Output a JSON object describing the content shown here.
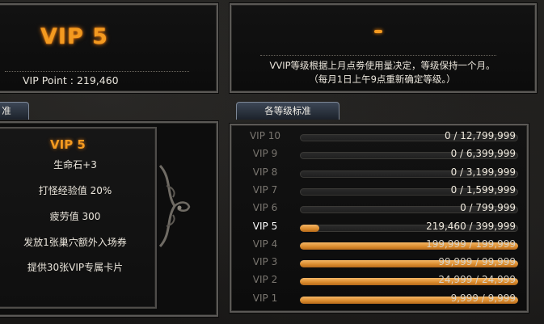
{
  "summary": {
    "level": "VIP 5",
    "point_line": "VIP Point : 219,460"
  },
  "info": {
    "desc_line1": "VVIP等级根据上月点劵使用量决定，等级保持一个月。",
    "desc_line2": "（每月1日上午9点重新确定等级。）"
  },
  "tabs": {
    "left_partial": "准",
    "right": "各等级标准"
  },
  "benefits": {
    "level": "VIP 5",
    "items": [
      "生命石+3",
      "打怪经验值 20%",
      "疲劳值 300",
      "发放1张巢穴额外入场券",
      "提供30张VIP专属卡片"
    ]
  },
  "levels": [
    {
      "label": "VIP 10",
      "text": "0 / 12,799,999",
      "progress": 0
    },
    {
      "label": "VIP 9",
      "text": "0 / 6,399,999",
      "progress": 0
    },
    {
      "label": "VIP 8",
      "text": "0 / 3,199,999",
      "progress": 0
    },
    {
      "label": "VIP 7",
      "text": "0 / 1,599,999",
      "progress": 0
    },
    {
      "label": "VIP 6",
      "text": "0 / 799,999",
      "progress": 0
    },
    {
      "label": "VIP 5",
      "text": "219,460 / 399,999",
      "progress": 0.09,
      "current": true
    },
    {
      "label": "VIP 4",
      "text": "199,999 / 199,999",
      "progress": 1
    },
    {
      "label": "VIP 3",
      "text": "99,999 / 99,999",
      "progress": 1
    },
    {
      "label": "VIP 2",
      "text": "24,999 / 24,999",
      "progress": 1
    },
    {
      "label": "VIP 1",
      "text": "9,999 / 9,999",
      "progress": 1
    }
  ],
  "colors": {
    "accent_orange": "#f39a20",
    "bar_fill": "#d98a2c",
    "panel_border": "#5b5956"
  }
}
